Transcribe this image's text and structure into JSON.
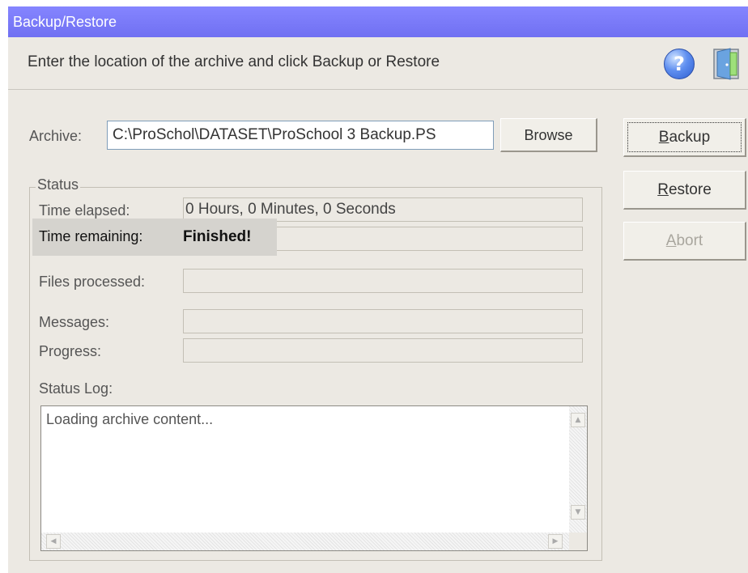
{
  "window": {
    "title": "Backup/Restore"
  },
  "header": {
    "instruction": "Enter the location of the archive and click Backup or Restore",
    "help_icon": "help-question-icon",
    "help_glyph": "?",
    "exit_icon": "exit-door-icon"
  },
  "archive": {
    "label": "Archive:",
    "value": "C:\\ProSchol\\DATASET\\ProSchool 3 Backup.PS",
    "browse_label": "Browse"
  },
  "actions": {
    "backup": {
      "accel": "B",
      "rest": "ackup"
    },
    "restore": {
      "accel": "R",
      "rest": "estore"
    },
    "abort": {
      "accel": "A",
      "rest": "bort"
    }
  },
  "status": {
    "group_label": "Status",
    "time_elapsed_label": "Time elapsed:",
    "time_elapsed_value": "0 Hours, 0 Minutes, 0 Seconds",
    "time_remaining_label": "Time remaining:",
    "time_remaining_value": "Finished!",
    "files_processed_label": "Files processed:",
    "files_processed_value": "",
    "messages_label": "Messages:",
    "messages_value": "",
    "progress_label": "Progress:",
    "progress_value": 0,
    "status_log_label": "Status Log:",
    "status_log_text": "Loading archive content..."
  },
  "colors": {
    "titlebar": "#7b7bfa",
    "window_bg": "#ece9e3"
  }
}
